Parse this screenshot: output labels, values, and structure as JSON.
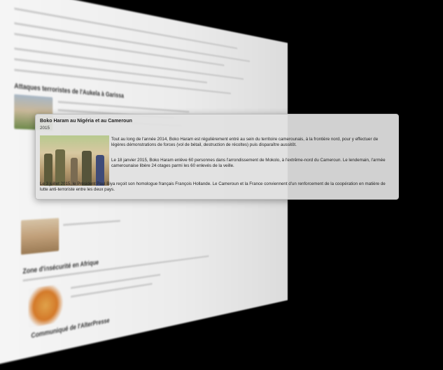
{
  "popup": {
    "title": "Boko Haram au Nigéria et au Cameroun",
    "year": "2015",
    "paragraphs": [
      "Tout au long de l'année 2014, Boko Haram est régulièrement entré au sein du territoire camerounais, à la frontière nord, pour y effectuer de légères démonstrations de forces (vol de bétail, destruction de récoltes) puis disparaître aussitôt.",
      "Le 18 janvier 2015, Boko Haram enlève 60 personnes dans l'arrondissement de Mokolo, à l'extrême-nord du Cameroun. Le lendemain, l'armée camerounaise libère 24 otages parmi les 60 enlevés de la veille.",
      "Le 3 juillet 2015, le Président Paul Biya reçoit son homologue français François Hollande. Le Cameroun et la France conviennent d'un renforcement de la coopération en matière de lutte anti-terroriste entre les deux pays."
    ]
  },
  "background_page": {
    "section_heading_1": "Attaques terroristes de l'Aukela à Garissa",
    "section_heading_2": "Zone d'insécurité en Afrique",
    "section_heading_3": "Communiqué de l'AlterPresse"
  },
  "colors": {
    "page_bg": "#000000",
    "card_bg": "#e1e1e1",
    "paper": "#f2f2f2"
  }
}
